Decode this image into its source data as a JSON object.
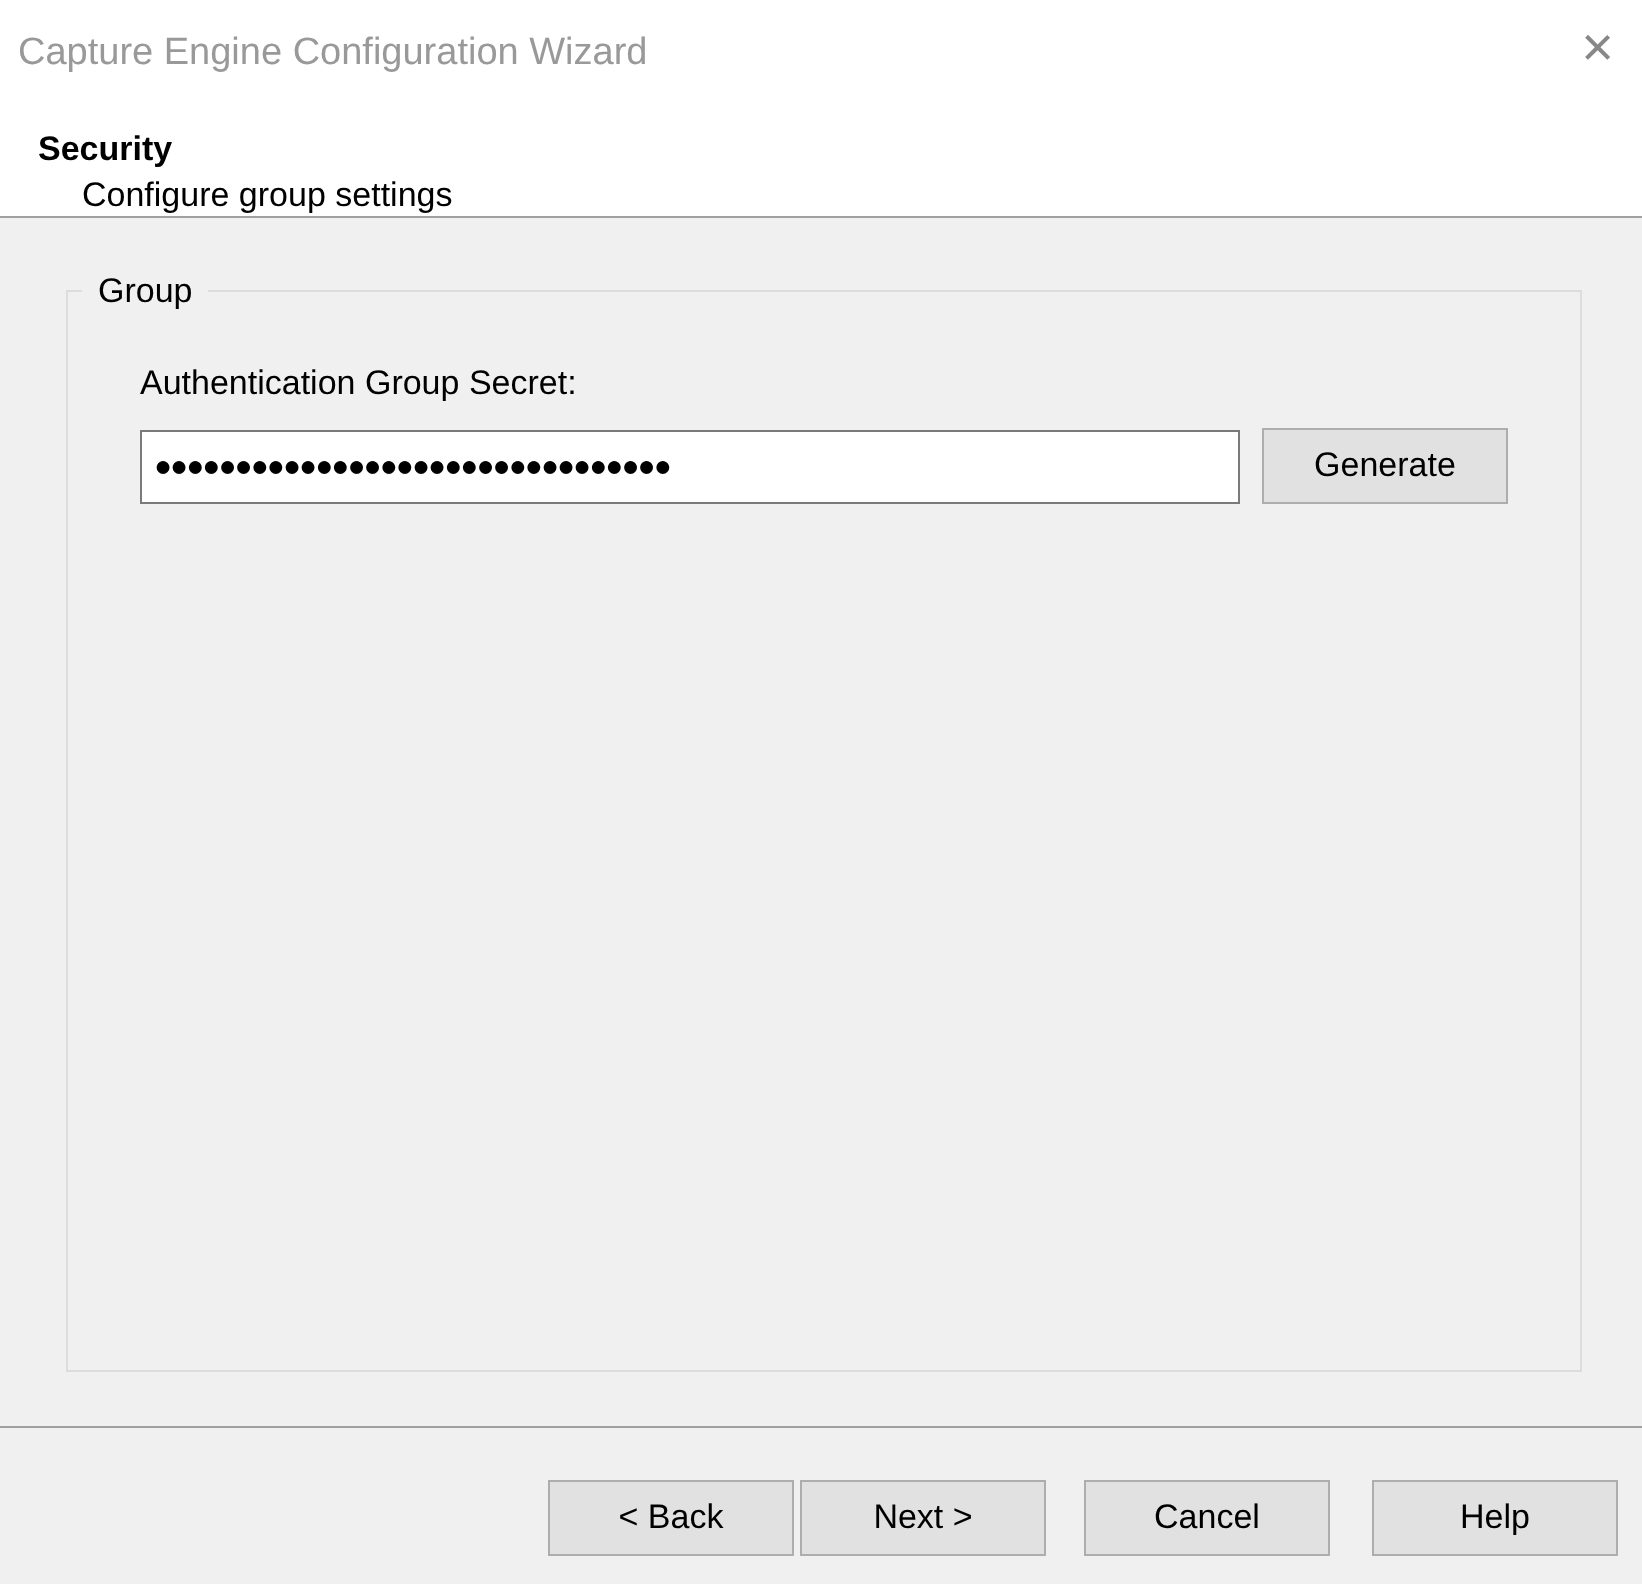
{
  "window": {
    "title": "Capture Engine Configuration Wizard",
    "close": "×"
  },
  "header": {
    "title": "Security",
    "subtitle": "Configure group settings"
  },
  "group": {
    "legend": "Group",
    "label": "Authentication Group Secret:",
    "secret_value": "●●●●●●●●●●●●●●●●●●●●●●●●●●●●●●●●",
    "button": "Generate"
  },
  "buttons": [
    "< Back",
    "Next >",
    "Cancel",
    "Help"
  ]
}
